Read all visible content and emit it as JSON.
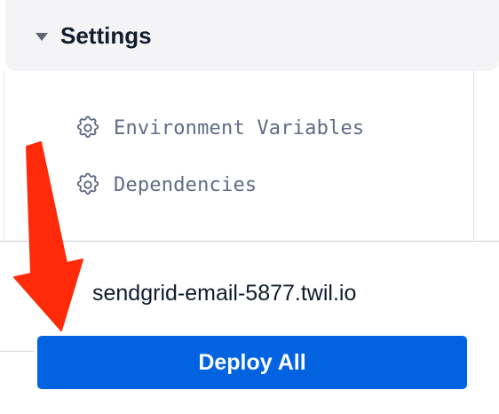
{
  "settings": {
    "title": "Settings",
    "items": [
      {
        "label": "Environment Variables",
        "icon": "gear-icon"
      },
      {
        "label": "Dependencies",
        "icon": "gear-icon"
      }
    ]
  },
  "deploy": {
    "domain": "sendgrid-email-5877.twil.io",
    "button_label": "Deploy All"
  },
  "colors": {
    "header_bg": "#f4f4f6",
    "button_bg": "#0263e0",
    "arrow": "#ff2a0a",
    "muted_text": "#606b85"
  }
}
